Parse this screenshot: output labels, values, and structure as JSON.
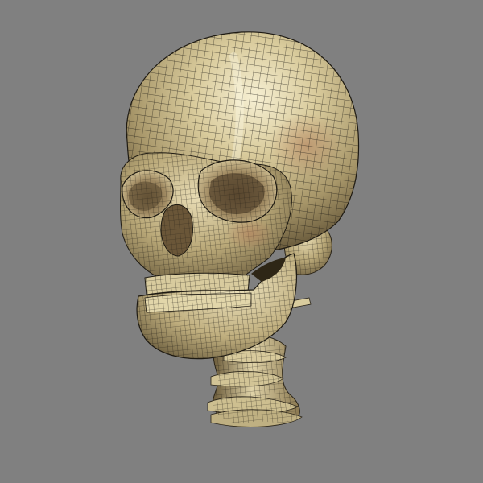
{
  "scene": {
    "subject": "skull-with-cervical-spine",
    "render_style": "wireframe-over-shaded",
    "colors": {
      "background": "#808080",
      "bone_light": "#efe6c4",
      "bone_mid": "#c9b98a",
      "bone_dark": "#6a5a38",
      "bone_shadow": "#3a3120",
      "wire": "#1a1712",
      "warm_tint": "#b07a58"
    }
  }
}
